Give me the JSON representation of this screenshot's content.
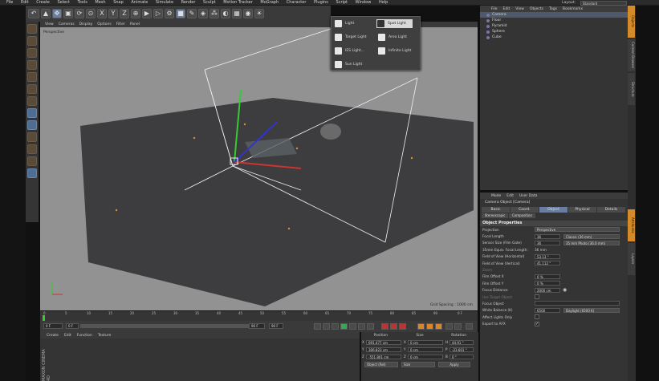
{
  "menubar": {
    "items": [
      "File",
      "Edit",
      "Create",
      "Select",
      "Tools",
      "Mesh",
      "Snap",
      "Animate",
      "Simulate",
      "Render",
      "Sculpt",
      "Motion Tracker",
      "MoGraph",
      "Character",
      "Plugins",
      "Script",
      "Window",
      "Help"
    ],
    "layout_label": "Layout:",
    "layout_value": "Standard"
  },
  "toolbar": {
    "icons": [
      "undo-icon",
      "select-icon",
      "move-icon",
      "scale-icon",
      "rotate-icon",
      "recent-icon",
      "x-axis-icon",
      "y-axis-icon",
      "z-axis-icon",
      "coord-system-icon",
      "render-view-icon",
      "render-picture-icon",
      "render-settings-icon",
      "cube-icon",
      "pen-icon",
      "subdivision-icon",
      "array-icon",
      "deformer-icon",
      "floor-icon",
      "camera-icon",
      "light-icon"
    ],
    "axis_labels": [
      "X",
      "Y",
      "Z"
    ]
  },
  "viewport": {
    "menu": [
      "View",
      "Cameras",
      "Display",
      "Options",
      "Filter",
      "Panel"
    ],
    "label": "Perspective",
    "grid_spacing": "Grid Spacing : 1000 cm"
  },
  "light_popup": {
    "items": [
      {
        "label": "Light",
        "icon": "light-icon"
      },
      {
        "label": "Spot Light",
        "icon": "spot-light-icon",
        "selected": true
      },
      {
        "label": "Target Light",
        "icon": "target-light-icon"
      },
      {
        "label": "Area Light",
        "icon": "area-light-icon"
      },
      {
        "label": "IES Light...",
        "icon": "ies-light-icon"
      },
      {
        "label": "Infinite Light",
        "icon": "infinite-light-icon"
      },
      {
        "label": "Sun Light",
        "icon": "sun-light-icon"
      }
    ]
  },
  "object_manager": {
    "menu": [
      "File",
      "Edit",
      "View",
      "Objects",
      "Tags",
      "Bookmarks"
    ],
    "objects": [
      {
        "name": "Camera",
        "selected": true
      },
      {
        "name": "Floor",
        "selected": false
      },
      {
        "name": "Pyramid",
        "selected": false
      },
      {
        "name": "Sphere",
        "selected": false
      },
      {
        "name": "Cube",
        "selected": false
      }
    ]
  },
  "side_tabs": [
    "Objects",
    "Content Browser",
    "Structure",
    "Attributes",
    "Layers"
  ],
  "attributes": {
    "menu": [
      "Mode",
      "Edit",
      "User Data"
    ],
    "title": "Camera Object [Camera]",
    "tabs": [
      "Basic",
      "Coord.",
      "Object",
      "Physical",
      "Details"
    ],
    "active_tab": "Object",
    "subtabs": [
      "Stereoscopic",
      "Composition"
    ],
    "section": "Object Properties",
    "props": [
      {
        "label": "Projection",
        "value": "Perspective"
      },
      {
        "label": "Focal Length",
        "value": "36",
        "extra": "Classic (36 mm)"
      },
      {
        "label": "Sensor Size (Film Gate)",
        "value": "36",
        "extra": "35 mm Photo (36.0 mm)"
      },
      {
        "label": "35mm Equiv. Focal Length:",
        "value": "36 mm"
      },
      {
        "label": "Field of View (Horizontal)",
        "value": "53.13 °"
      },
      {
        "label": "Field of View (Vertical)",
        "value": "41.112 °"
      },
      {
        "label": "Zoom",
        "value": ""
      },
      {
        "label": "Film Offset X",
        "value": "0 %"
      },
      {
        "label": "Film Offset Y",
        "value": "0 %"
      },
      {
        "label": "Focus Distance",
        "value": "2000 cm"
      },
      {
        "label": "Use Target Object",
        "value": ""
      },
      {
        "label": "Focus Object",
        "value": ""
      },
      {
        "label": "White Balance (K)",
        "value": "6500",
        "extra": "Daylight (6500 K)"
      },
      {
        "label": "Affect Lights Only",
        "value": ""
      },
      {
        "label": "Export to AFX",
        "value": "✓"
      }
    ]
  },
  "timeline": {
    "ticks": [
      "0",
      "5",
      "10",
      "15",
      "20",
      "25",
      "30",
      "35",
      "40",
      "45",
      "50",
      "55",
      "60",
      "65",
      "70",
      "75",
      "80",
      "85",
      "90"
    ],
    "frame_end_label": "0 F",
    "start_field": "0 F",
    "min_field": "0 F",
    "max_field": "90 F",
    "end_field": "90 F"
  },
  "material_manager": {
    "menu": [
      "Create",
      "Edit",
      "Function",
      "Texture"
    ],
    "logo": "MAXON CINEMA 4D"
  },
  "coordinates": {
    "headers": [
      "Position",
      "Size",
      "Rotation"
    ],
    "rows": [
      {
        "axis": "X",
        "pos": "691.477 cm",
        "size_axis": "X",
        "size": "0 cm",
        "rot_axis": "H",
        "rot": "44.91 °"
      },
      {
        "axis": "Y",
        "pos": "306.823 cm",
        "size_axis": "Y",
        "size": "0 cm",
        "rot_axis": "P",
        "rot": "-23.601 °"
      },
      {
        "axis": "Z",
        "pos": "-551.801 cm",
        "size_axis": "Z",
        "size": "0 cm",
        "rot_axis": "B",
        "rot": "0 °"
      }
    ],
    "mode_select": "Object (Rel)",
    "size_select": "Size",
    "apply_label": "Apply"
  }
}
